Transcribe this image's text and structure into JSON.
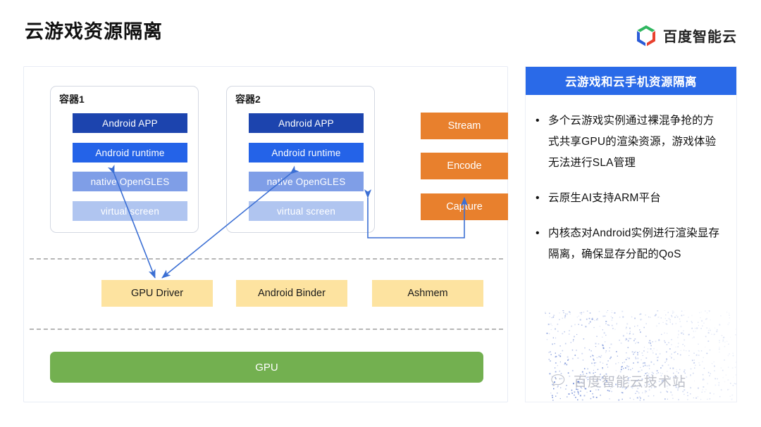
{
  "header": {
    "title": "云游戏资源隔离",
    "brand_name": "百度智能云",
    "brand_logo_icon": "baidu-cloud-hexagon-icon",
    "brand_colors": {
      "green": "#30b760",
      "blue": "#2a5bd7",
      "red": "#e8412e"
    }
  },
  "diagram": {
    "containers": [
      {
        "title": "容器1",
        "layers": [
          {
            "label": "Android APP",
            "color": "#1c44ae"
          },
          {
            "label": "Android runtime",
            "color": "#2463e8"
          },
          {
            "label": "native OpenGLES",
            "color": "#7f9ee7"
          },
          {
            "label": "virtual screen",
            "color": "#b0c5f0"
          }
        ]
      },
      {
        "title": "容器2",
        "layers": [
          {
            "label": "Android APP",
            "color": "#1c44ae"
          },
          {
            "label": "Android runtime",
            "color": "#2463e8"
          },
          {
            "label": "native OpenGLES",
            "color": "#7f9ee7"
          },
          {
            "label": "virtual screen",
            "color": "#b0c5f0"
          }
        ]
      }
    ],
    "pipeline": [
      {
        "label": "Stream",
        "color": "#e8802d"
      },
      {
        "label": "Encode",
        "color": "#e8802d"
      },
      {
        "label": "Capture",
        "color": "#e8802d"
      }
    ],
    "kernel_row": [
      {
        "label": "GPU Driver",
        "color": "#fde3a0"
      },
      {
        "label": "Android Binder",
        "color": "#fde3a0"
      },
      {
        "label": "Ashmem",
        "color": "#fde3a0"
      }
    ],
    "hardware": {
      "label": "GPU",
      "color": "#73b050"
    },
    "connector_color": "#3b6fd4",
    "divider_color": "#b6b6b6"
  },
  "side_panel": {
    "header_title": "云游戏和云手机资源隔离",
    "header_color": "#2a6ae8",
    "bullet_marker": "•",
    "bullets": [
      "多个云游戏实例通过裸混争抢的方式共享GPU的渲染资源，游戏体验无法进行SLA管理",
      "云原生AI支持ARM平台",
      "内核态对Android实例进行渲染显存隔离，确保显存分配的QoS"
    ]
  },
  "watermark": {
    "text": "百度智能云技术站",
    "icon": "wechat-icon",
    "color": "#b9bcc6",
    "dot_color": "#3f63c8"
  }
}
